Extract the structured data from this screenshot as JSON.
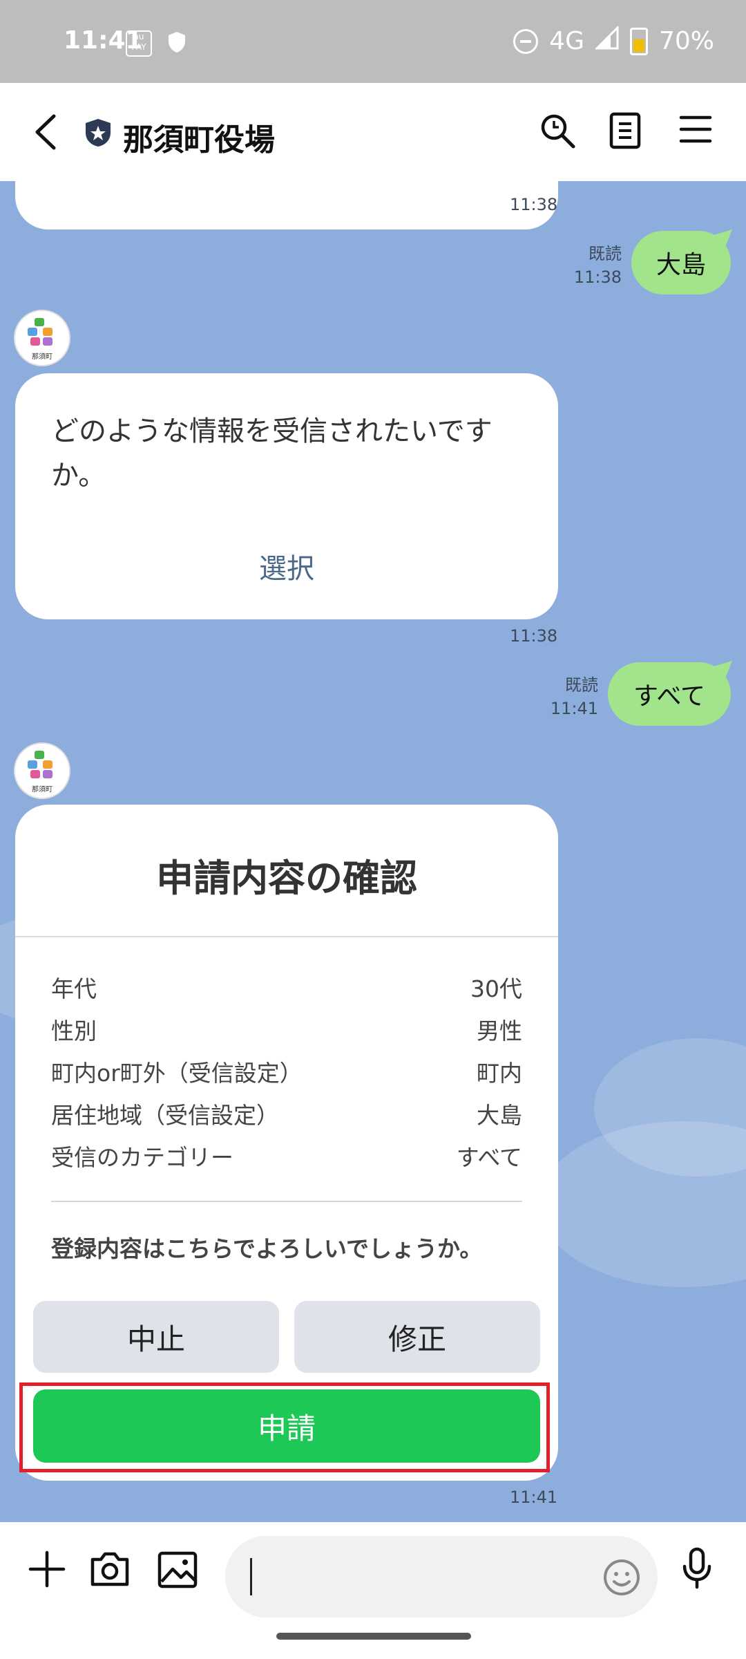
{
  "status_bar": {
    "time": "11:41",
    "pay_icon_label": "au PAY",
    "network": "4G",
    "battery": "70%"
  },
  "header": {
    "title": "那須町役場",
    "icons": [
      "back-arrow-icon",
      "official-badge-icon",
      "search-icon",
      "notes-icon",
      "menu-icon"
    ]
  },
  "messages": {
    "prev_time": "11:38",
    "user_reply_1": {
      "text": "大島",
      "read": "既読",
      "time": "11:38"
    },
    "bot_question": {
      "text": "どのような情報を受信されたいですか。",
      "button": "選択",
      "time": "11:38"
    },
    "user_reply_2": {
      "text": "すべて",
      "read": "既読",
      "time": "11:41"
    },
    "avatar_label": "那須町",
    "confirm_card": {
      "title": "申請内容の確認",
      "rows": [
        {
          "label": "年代",
          "value": "30代"
        },
        {
          "label": "性別",
          "value": "男性"
        },
        {
          "label": "町内or町外（受信設定）",
          "value": "町内"
        },
        {
          "label": "居住地域（受信設定）",
          "value": "大島"
        },
        {
          "label": "受信のカテゴリー",
          "value": "すべて"
        }
      ],
      "question": "登録内容はこちらでよろしいでしょうか。",
      "cancel_label": "中止",
      "edit_label": "修正",
      "submit_label": "申請",
      "time": "11:41"
    }
  },
  "input_bar": {
    "icons": [
      "plus-icon",
      "camera-icon",
      "image-icon",
      "emoji-icon",
      "microphone-icon"
    ],
    "placeholder": ""
  },
  "colors": {
    "chat_background": "#8daddc",
    "my_bubble": "#a1e48c",
    "submit_button": "#1ec856",
    "highlight_box": "#e0212b"
  }
}
